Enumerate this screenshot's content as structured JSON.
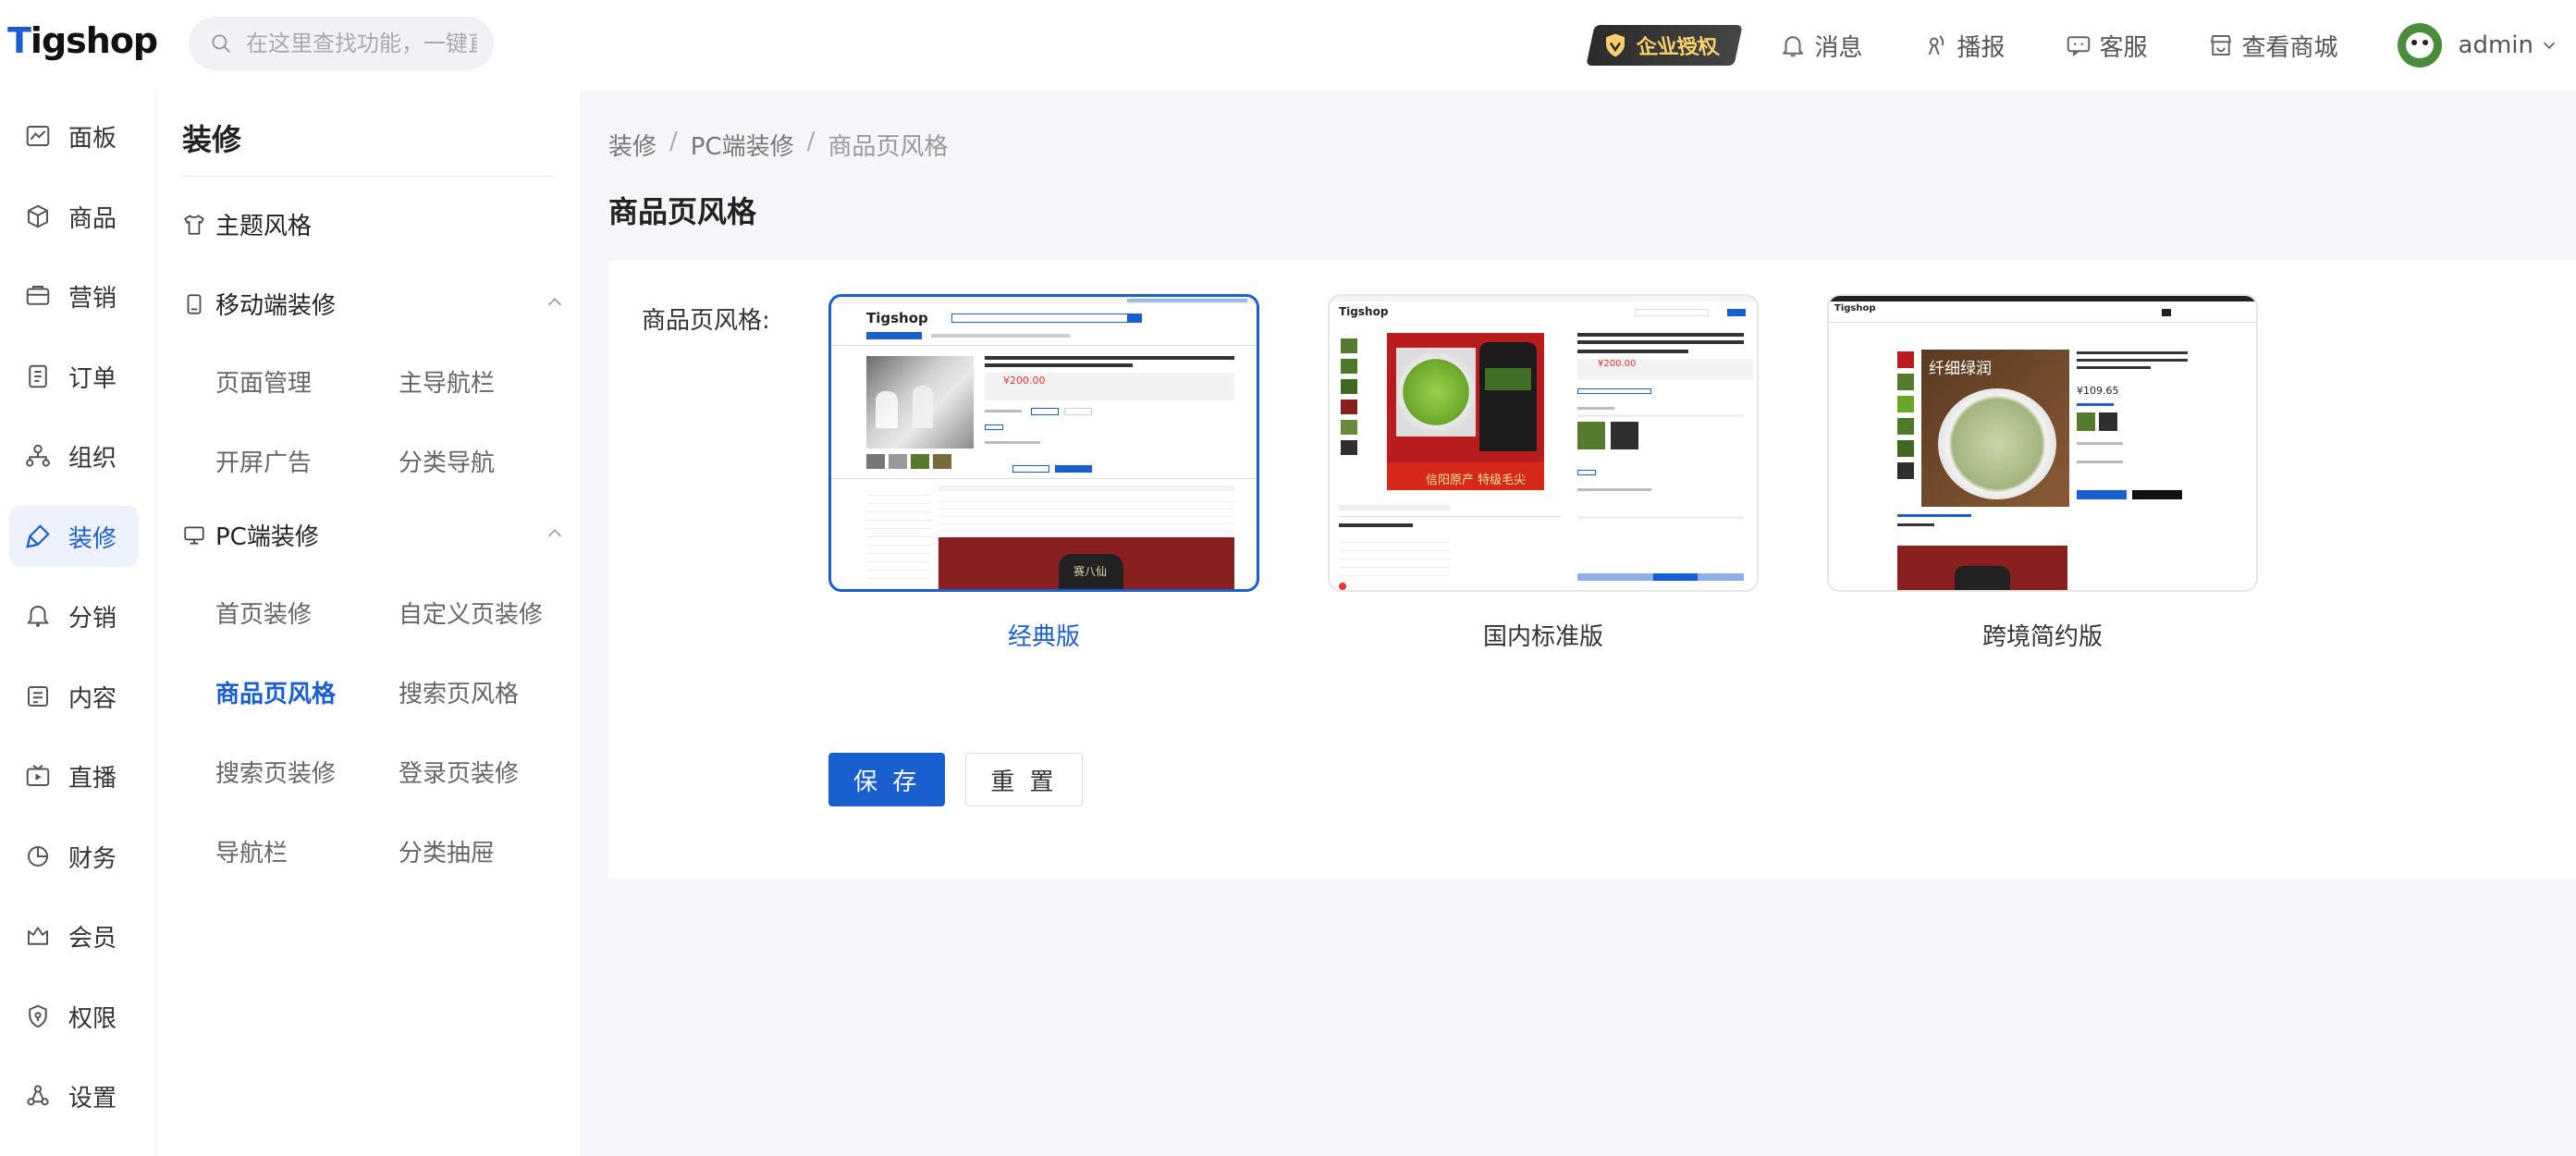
{
  "app": {
    "logo": "Tigshop",
    "logo_rest": "igshop",
    "logo_first": "T"
  },
  "search": {
    "placeholder": "在这里查找功能，一键直达"
  },
  "topbar": {
    "license_badge": "企业授权",
    "items": [
      {
        "label": "消息",
        "icon": "bell-icon"
      },
      {
        "label": "播报",
        "icon": "broadcast-icon"
      },
      {
        "label": "客服",
        "icon": "chat-icon"
      },
      {
        "label": "查看商城",
        "icon": "store-icon"
      }
    ],
    "user": "admin"
  },
  "leftnav": [
    {
      "label": "面板",
      "icon": "chart-icon"
    },
    {
      "label": "商品",
      "icon": "box-icon"
    },
    {
      "label": "营销",
      "icon": "marketing-icon"
    },
    {
      "label": "订单",
      "icon": "order-icon"
    },
    {
      "label": "组织",
      "icon": "org-icon"
    },
    {
      "label": "装修",
      "icon": "decorate-icon",
      "active": true
    },
    {
      "label": "分销",
      "icon": "distribution-icon"
    },
    {
      "label": "内容",
      "icon": "content-icon"
    },
    {
      "label": "直播",
      "icon": "live-icon"
    },
    {
      "label": "财务",
      "icon": "finance-icon"
    },
    {
      "label": "会员",
      "icon": "member-icon"
    },
    {
      "label": "权限",
      "icon": "permission-icon"
    },
    {
      "label": "设置",
      "icon": "settings-icon"
    }
  ],
  "subnav": {
    "title": "装修",
    "theme": "主题风格",
    "mobile_group": "移动端装修",
    "mobile_links": [
      "页面管理",
      "主导航栏",
      "开屏广告",
      "分类导航"
    ],
    "pc_group": "PC端装修",
    "pc_links": [
      "首页装修",
      "自定义页装修",
      "商品页风格",
      "搜索页风格",
      "搜索页装修",
      "登录页装修",
      "导航栏",
      "分类抽屉"
    ]
  },
  "breadcrumb": [
    "装修",
    "PC端装修",
    "商品页风格"
  ],
  "page": {
    "title": "商品页风格"
  },
  "form": {
    "label": "商品页风格:",
    "styles": [
      {
        "name": "经典版",
        "selected": true
      },
      {
        "name": "国内标准版",
        "selected": false
      },
      {
        "name": "跨境简约版",
        "selected": false
      }
    ],
    "thumb_text": {
      "classic_logo": "Tigshop",
      "classic_price": "¥200.00",
      "domestic_logo": "Tigshop",
      "domestic_price": "¥200.00",
      "domestic_promo": "信阳原产 特级毛尖",
      "cross_logo": "Tigshop",
      "cross_price": "¥109.65",
      "cross_banner": "纤细绿润",
      "jar": "赛八仙"
    },
    "save": "保 存",
    "reset": "重 置"
  },
  "colors": {
    "accent": "#1a5fd0",
    "nav_active_bg": "#edf2fe"
  }
}
